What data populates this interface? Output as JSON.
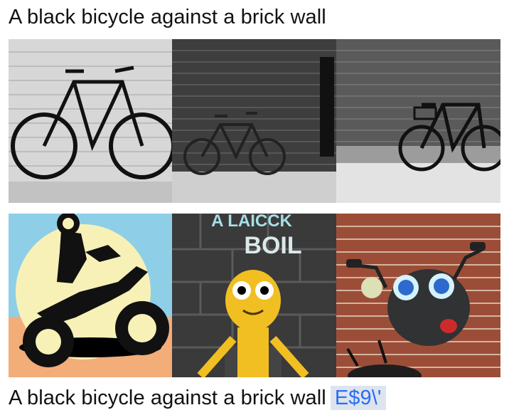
{
  "top_caption": "A black bicycle against a brick wall",
  "bottom_caption": {
    "text": "A black bicycle against a brick wall",
    "suffix": "E$9\\'"
  },
  "images": {
    "row1": [
      {
        "name": "bicycle-white-brick-wall-image"
      },
      {
        "name": "bicycle-grey-brick-wall-image"
      },
      {
        "name": "bicycle-dark-brick-wall-image"
      }
    ],
    "row2": [
      {
        "name": "cartoon-motorcycle-image"
      },
      {
        "name": "robot-poster-image",
        "poster_text": [
          "A LAICCK",
          "BOIL"
        ]
      },
      {
        "name": "cartoon-scooter-brick-image"
      }
    ]
  }
}
